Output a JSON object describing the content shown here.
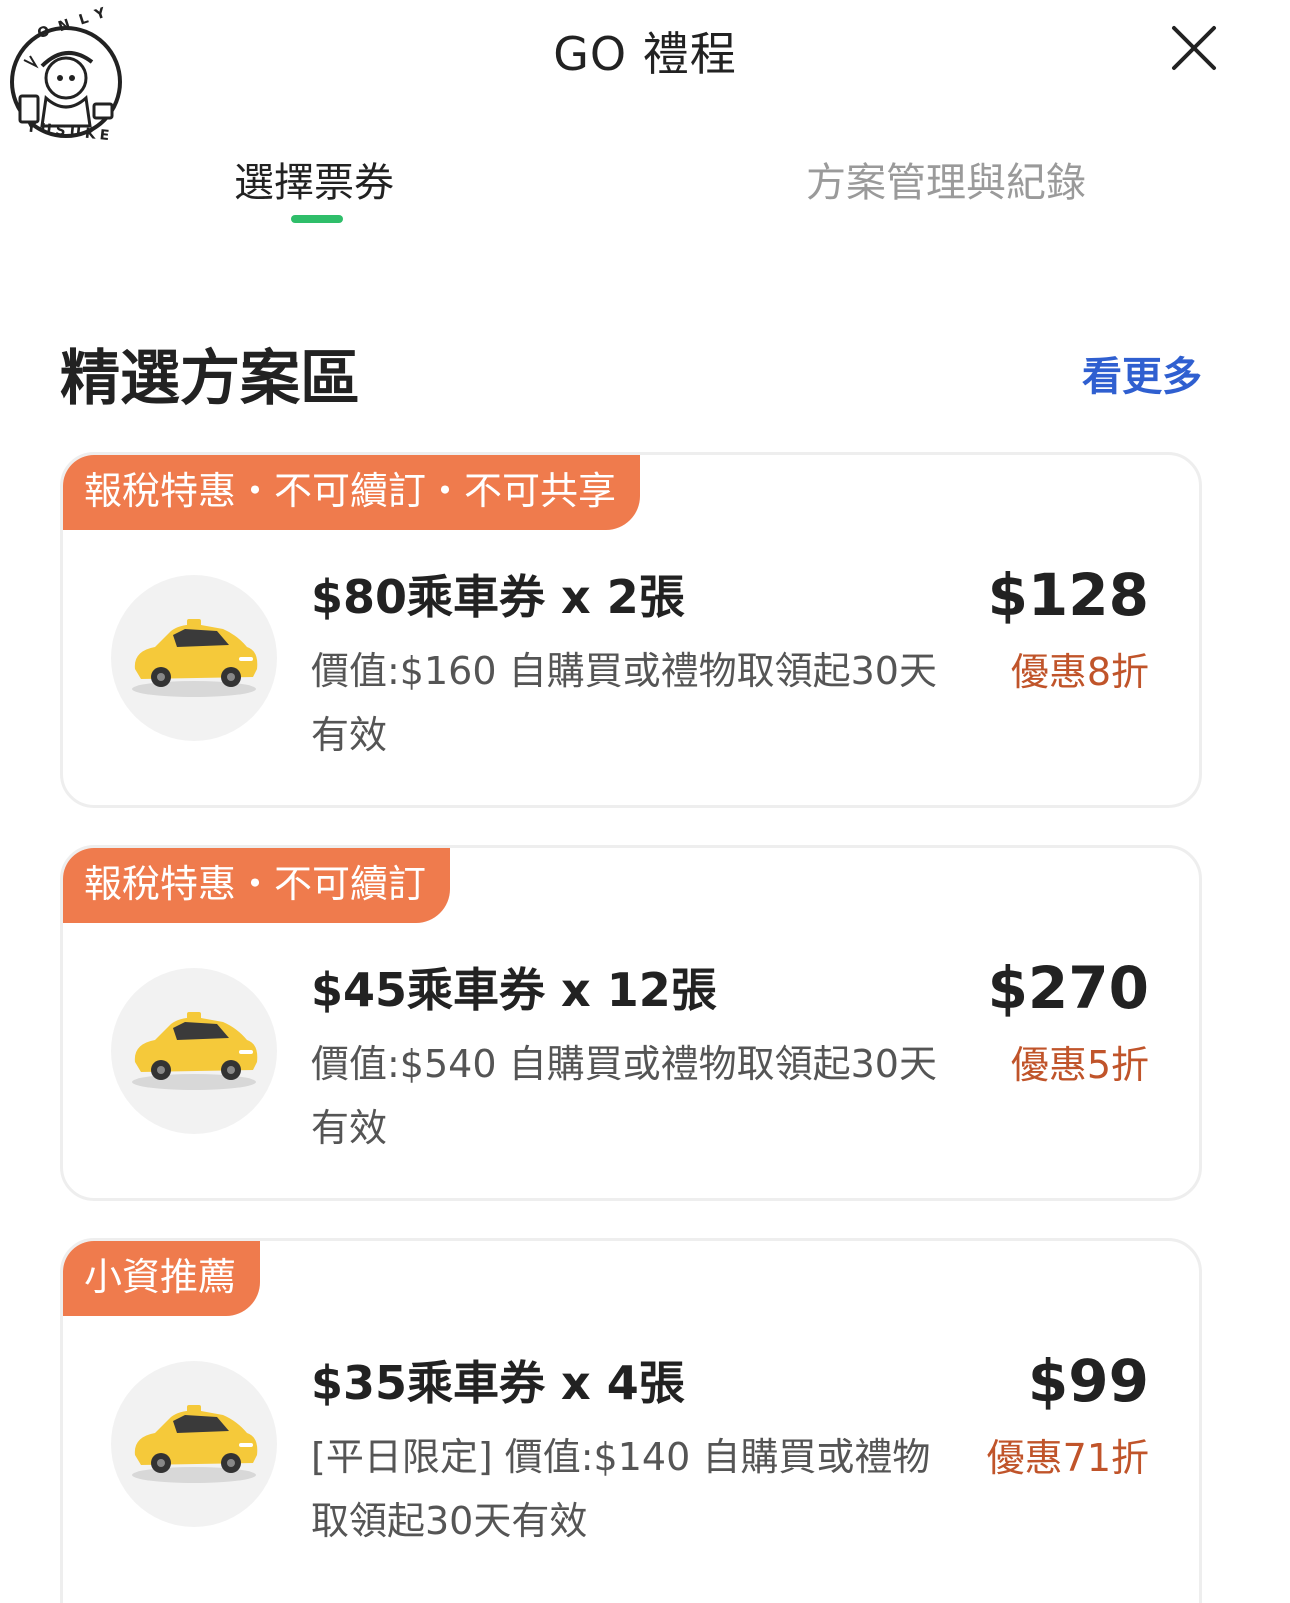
{
  "header": {
    "title": "GO 禮程",
    "close_icon": "close-icon"
  },
  "watermark": {
    "text_top": "ONLY",
    "text_bottom": "YUSUKE"
  },
  "tabs": [
    {
      "label": "選擇票券",
      "active": true
    },
    {
      "label": "方案管理與紀錄",
      "active": false
    }
  ],
  "section": {
    "title": "精選方案區",
    "see_more": "看更多"
  },
  "plans": [
    {
      "tag": "報稅特惠・不可續訂・不可共享",
      "title": "$80乘車券 x 2張",
      "desc": "價值:$160 自購買或禮物取領起30天有效",
      "price": "$128",
      "discount": "優惠8折",
      "icon": "taxi-car-icon"
    },
    {
      "tag": "報稅特惠・不可續訂",
      "title": "$45乘車券 x 12張",
      "desc": "價值:$540 自購買或禮物取領起30天有效",
      "price": "$270",
      "discount": "優惠5折",
      "icon": "taxi-car-icon"
    },
    {
      "tag": "小資推薦",
      "title": "$35乘車券 x 4張",
      "desc": "[平日限定] 價值:$140 自購買或禮物取領起30天有效",
      "price": "$99",
      "discount": "優惠71折",
      "icon": "taxi-car-icon"
    }
  ],
  "colors": {
    "accent_green": "#2fbe6a",
    "tag_orange": "#ef7b4d",
    "link_blue": "#2f5fd0",
    "discount_text": "#c0542a"
  }
}
